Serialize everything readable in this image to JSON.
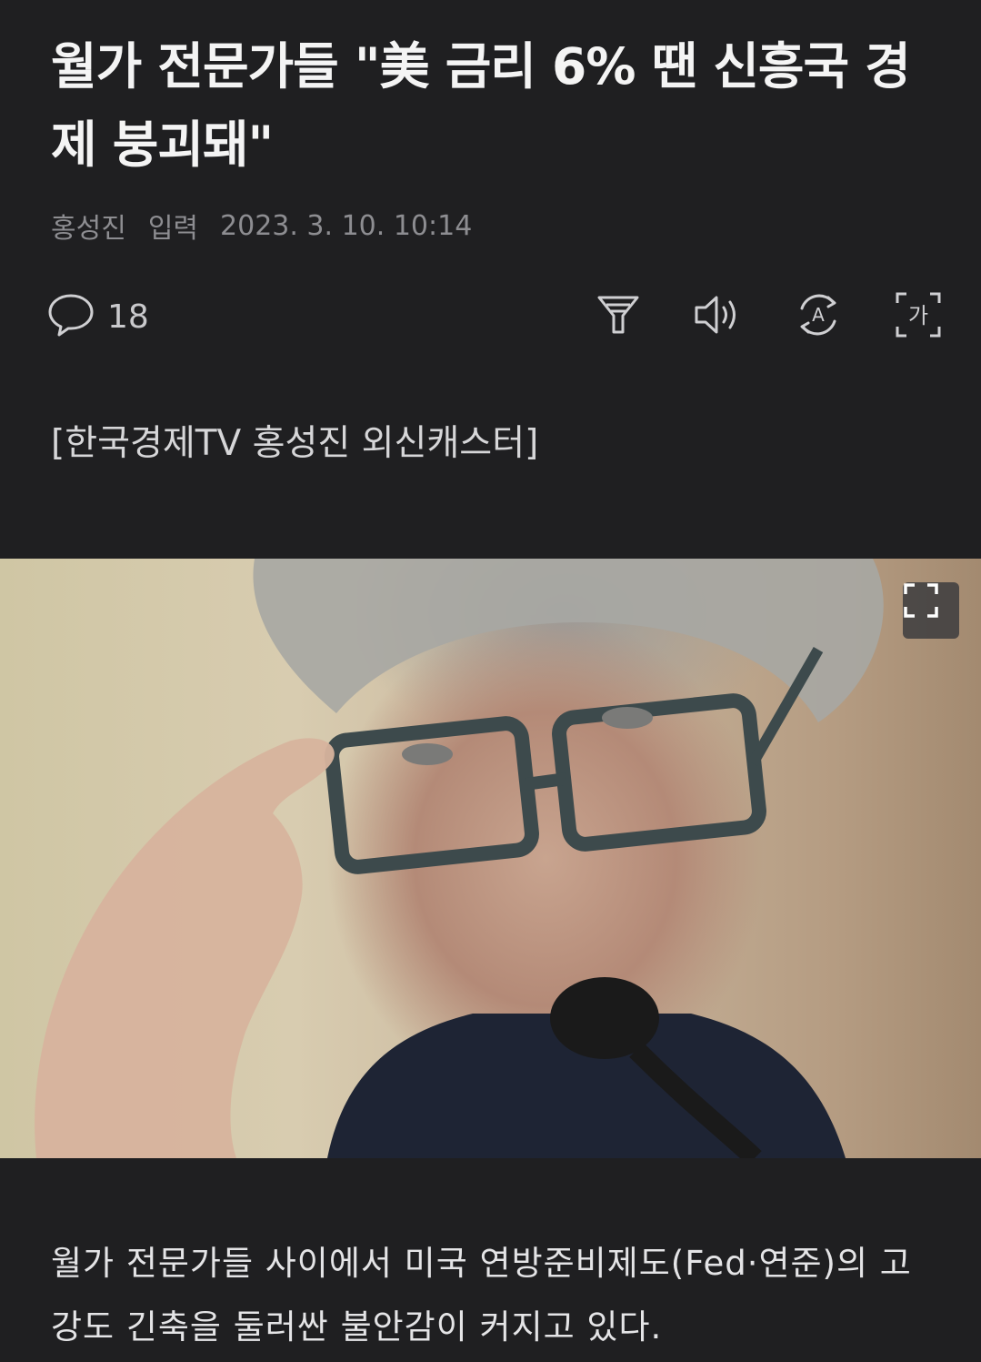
{
  "article": {
    "headline": "월가 전문가들 \"美 금리 6% 땐 신흥국 경제 붕괴돼\"",
    "author": "홍성진",
    "input_label": "입력",
    "published": "2023. 3. 10. 10:14",
    "comment_count": "18",
    "byline": "[한국경제TV 홍성진 외신캐스터]",
    "body": "월가 전문가들 사이에서 미국 연방준비제도(Fed·연준)의 고강도 긴축을 둘러싼 불안감이 커지고 있다."
  },
  "toolbar": {
    "icons": [
      "comment-icon",
      "filter-icon",
      "speaker-icon",
      "translate-icon",
      "font-size-icon"
    ],
    "font_icon_char": "가",
    "translate_icon_char": "A"
  },
  "photo": {
    "icon": "expand-icon"
  },
  "colors": {
    "background": "#1f1f21",
    "text": "#f4f4f4",
    "muted": "#8d8d91"
  }
}
